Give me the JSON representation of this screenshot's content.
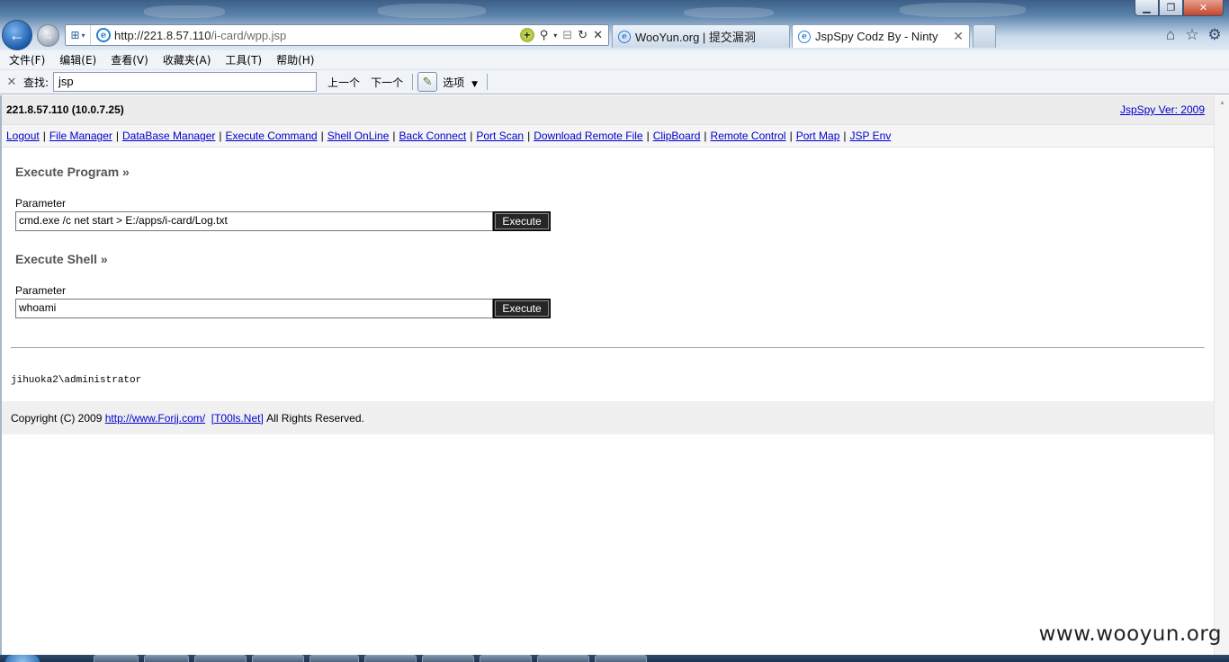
{
  "browser": {
    "url_host": "http://221.8.57.110",
    "url_path": "/i-card/wpp.jsp",
    "tabs": [
      {
        "title": "WooYun.org | 提交漏洞",
        "active": false
      },
      {
        "title": "JspSpy Codz By - Ninty",
        "active": true
      }
    ],
    "menu": [
      "文件(F)",
      "编辑(E)",
      "查看(V)",
      "收藏夹(A)",
      "工具(T)",
      "帮助(H)"
    ],
    "find": {
      "label": "查找:",
      "value": "jsp",
      "prev_label": "上一个",
      "next_label": "下一个",
      "options_label": "选项"
    }
  },
  "page": {
    "host_info": "221.8.57.110 (10.0.7.25)",
    "version_link": "JspSpy Ver: 2009",
    "nav": [
      "Logout",
      "File Manager",
      "DataBase Manager",
      "Execute Command",
      "Shell OnLine",
      "Back Connect",
      "Port Scan",
      "Download Remote File",
      "ClipBoard",
      "Remote Control",
      "Port Map",
      "JSP Env"
    ],
    "execute_program": {
      "title": "Execute Program »",
      "param_label": "Parameter",
      "value": "cmd.exe /c net start > E:/apps/i-card/Log.txt",
      "button": "Execute"
    },
    "execute_shell": {
      "title": "Execute Shell »",
      "param_label": "Parameter",
      "value": "whoami",
      "button": "Execute"
    },
    "output": "jihuoka2\\administrator",
    "footer": {
      "prefix": "Copyright (C) 2009",
      "link1": "http://www.Forjj.com/",
      "link2": "[T00ls.Net]",
      "suffix": "All Rights Reserved."
    }
  },
  "watermark": "www.wooyun.org",
  "colors": {
    "link": "#0000cc",
    "section_title": "#555555",
    "button_bg": "#262626"
  }
}
